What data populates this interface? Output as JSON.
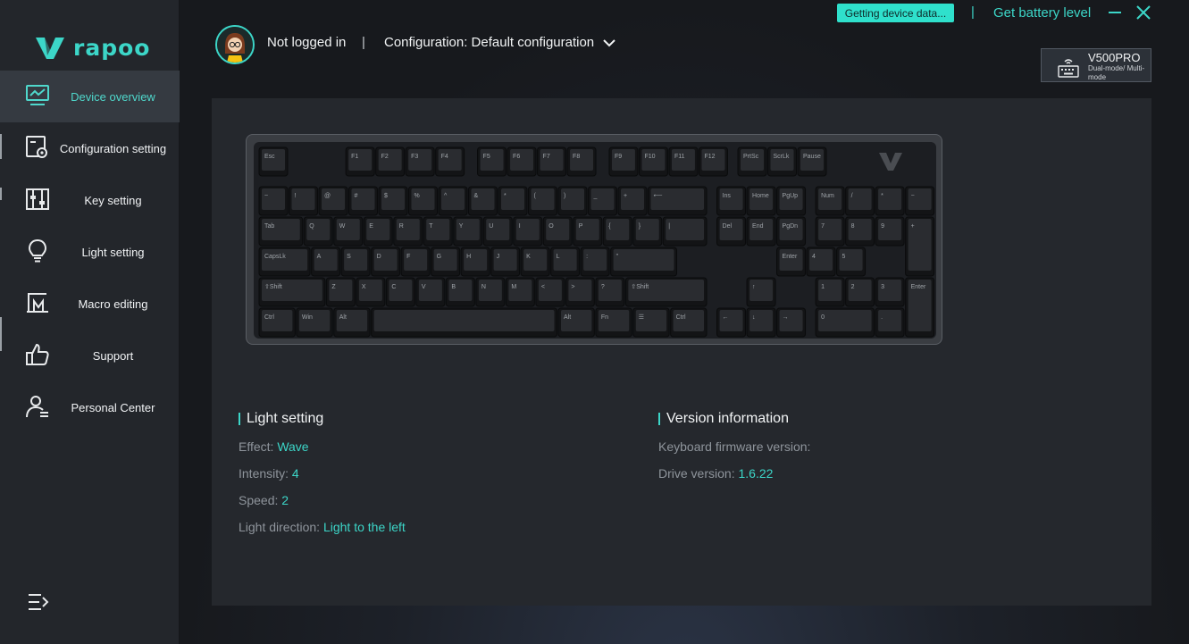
{
  "brand": {
    "logo_text": "rapoo",
    "accent": "#3cd6c8"
  },
  "sidebar": {
    "items": [
      {
        "label": "Device overview",
        "icon": "monitor-chart-icon",
        "active": true
      },
      {
        "label": "Configuration setting",
        "icon": "settings-panel-icon",
        "active": false
      },
      {
        "label": "Key setting",
        "icon": "sliders-icon",
        "active": false
      },
      {
        "label": "Light setting",
        "icon": "lightbulb-icon",
        "active": false
      },
      {
        "label": "Macro editing",
        "icon": "macro-icon",
        "active": false
      },
      {
        "label": "Support",
        "icon": "thumbs-up-icon",
        "active": false
      },
      {
        "label": "Personal Center",
        "icon": "user-icon",
        "active": false
      }
    ]
  },
  "header": {
    "user": "Not logged in",
    "separator": "|",
    "configuration": "Configuration: Default configuration",
    "status": "Getting device data...",
    "top_separator": "|",
    "battery_link": "Get battery level"
  },
  "device": {
    "name": "V500PRO",
    "mode": "Dual-mode/ Multi-mode"
  },
  "light_setting": {
    "title": "Light setting",
    "effect_label": "Effect:",
    "effect_value": "Wave",
    "intensity_label": "Intensity:",
    "intensity_value": "4",
    "speed_label": "Speed:",
    "speed_value": "2",
    "direction_label": "Light direction:",
    "direction_value": "Light to the left"
  },
  "version_info": {
    "title": "Version information",
    "firmware_label": "Keyboard firmware version:",
    "firmware_value": "",
    "drive_label": "Drive version:",
    "drive_value": "1.6.22"
  },
  "keyboard_rows": [
    [
      "Esc",
      "F1",
      "F2",
      "F3",
      "F4",
      "F5",
      "F6",
      "F7",
      "F8",
      "F9",
      "F10",
      "F11",
      "F12",
      "PrtSc",
      "ScrLk",
      "Pause"
    ],
    [
      "~",
      "!",
      "@",
      "#",
      "$",
      "%",
      "^",
      "&",
      "*",
      "(",
      ")",
      "_",
      "+",
      "⟵",
      "Ins",
      "Home",
      "PgUp",
      "Num",
      "/",
      "*",
      "−"
    ],
    [
      "Tab",
      "Q",
      "W",
      "E",
      "R",
      "T",
      "Y",
      "U",
      "I",
      "O",
      "P",
      "{",
      "}",
      "|",
      "Del",
      "End",
      "PgDn",
      "7",
      "8",
      "9",
      "+"
    ],
    [
      "CapsLk",
      "A",
      "S",
      "D",
      "F",
      "G",
      "H",
      "J",
      "K",
      "L",
      ":",
      "\"",
      "Enter",
      "4",
      "5",
      "6"
    ],
    [
      "⇧Shift",
      "Z",
      "X",
      "C",
      "V",
      "B",
      "N",
      "M",
      "<",
      ">",
      "?",
      "⇧Shift",
      "↑",
      "1",
      "2",
      "3",
      "Enter"
    ],
    [
      "Ctrl",
      "Win",
      "Alt",
      "",
      "Alt",
      "Fn",
      "☰",
      "Ctrl",
      "←",
      "↓",
      "→",
      "0",
      "."
    ]
  ]
}
